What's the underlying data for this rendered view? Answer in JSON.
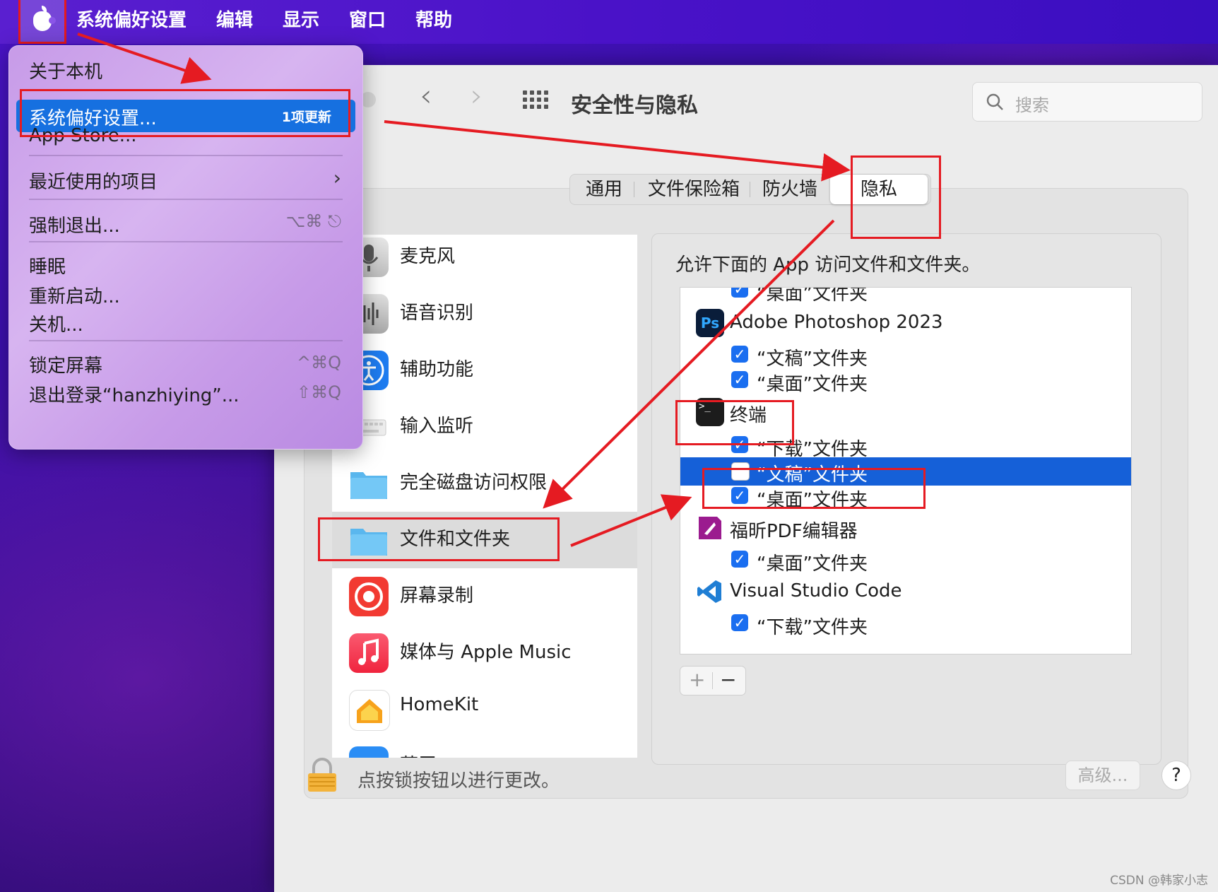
{
  "menubar": {
    "app_name": "系统偏好设置",
    "items": [
      "编辑",
      "显示",
      "窗口",
      "帮助"
    ]
  },
  "apple_menu": {
    "about": "关于本机",
    "system_prefs": "系统偏好设置...",
    "system_prefs_badge": "1项更新",
    "app_store": "App Store...",
    "recent_items": "最近使用的项目",
    "force_quit": "强制退出...",
    "force_quit_shortcut": "⌥⌘",
    "sleep": "睡眠",
    "restart": "重新启动...",
    "shutdown": "关机...",
    "lock_screen": "锁定屏幕",
    "lock_screen_shortcut": "^⌘Q",
    "logout": "退出登录“hanzhiying”...",
    "logout_shortcut": "⇧⌘Q"
  },
  "window": {
    "title": "安全性与隐私",
    "search_placeholder": "搜索",
    "tabs": [
      "通用",
      "文件保险箱",
      "防火墙",
      "隐私"
    ],
    "selected_tab": "隐私"
  },
  "sidebar": {
    "items": [
      {
        "label": "麦克风",
        "icon": "microphone-icon"
      },
      {
        "label": "语音识别",
        "icon": "speech-recognition-icon"
      },
      {
        "label": "辅助功能",
        "icon": "accessibility-icon"
      },
      {
        "label": "输入监听",
        "icon": "keyboard-icon"
      },
      {
        "label": "完全磁盘访问权限",
        "icon": "folder-icon"
      },
      {
        "label": "文件和文件夹",
        "icon": "folder-icon",
        "selected": true
      },
      {
        "label": "屏幕录制",
        "icon": "screen-record-icon"
      },
      {
        "label": "媒体与 Apple Music",
        "icon": "music-icon"
      },
      {
        "label": "HomeKit",
        "icon": "home-icon"
      },
      {
        "label": "蓝牙",
        "icon": "bluetooth-icon"
      }
    ]
  },
  "main": {
    "description": "允许下面的 App 访问文件和文件夹。",
    "list": [
      {
        "type": "sub",
        "label": "“桌面”文件夹",
        "checked": true
      },
      {
        "type": "app",
        "label": "Adobe Photoshop 2023",
        "icon": "photoshop-icon"
      },
      {
        "type": "sub",
        "label": "“文稿”文件夹",
        "checked": true
      },
      {
        "type": "sub",
        "label": "“桌面”文件夹",
        "checked": true
      },
      {
        "type": "app",
        "label": "终端",
        "icon": "terminal-icon"
      },
      {
        "type": "sub",
        "label": "“下载”文件夹",
        "checked": true
      },
      {
        "type": "sub",
        "label": "“文稿”文件夹",
        "checked": false,
        "selected": true
      },
      {
        "type": "sub",
        "label": "“桌面”文件夹",
        "checked": true
      },
      {
        "type": "app",
        "label": "福昕PDF编辑器",
        "icon": "foxit-pdf-icon"
      },
      {
        "type": "sub",
        "label": "“桌面”文件夹",
        "checked": true
      },
      {
        "type": "app",
        "label": "Visual Studio Code",
        "icon": "vscode-icon"
      },
      {
        "type": "sub",
        "label": "“下载”文件夹",
        "checked": true
      }
    ],
    "add_label": "+",
    "remove_label": "−"
  },
  "bottom": {
    "lock_text": "点按锁按钮以进行更改。",
    "advanced": "高级...",
    "help": "?"
  },
  "watermark": "CSDN @韩家小志",
  "colors": {
    "annotation": "#e51b22",
    "selection": "#1560d8",
    "checkbox": "#1a6ef0"
  }
}
